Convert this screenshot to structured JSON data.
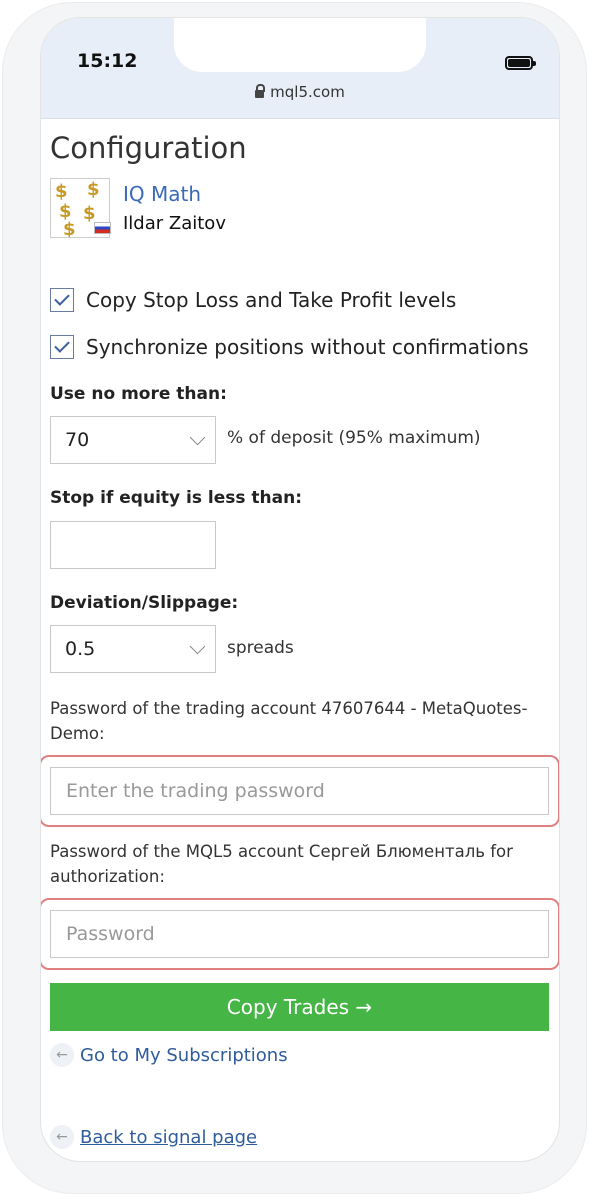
{
  "status_bar": {
    "time": "15:12",
    "url": "mql5.com"
  },
  "page": {
    "title": "Configuration",
    "signal": {
      "name": "IQ Math",
      "author": "Ildar Zaitov"
    },
    "checkboxes": [
      {
        "label": "Copy Stop Loss and Take Profit levels",
        "checked": true
      },
      {
        "label": "Synchronize positions without confirmations",
        "checked": true
      }
    ],
    "deposit": {
      "label": "Use no more than:",
      "value": "70",
      "suffix": "% of deposit (95% maximum)"
    },
    "equity": {
      "label": "Stop if equity is less than:",
      "value": ""
    },
    "deviation": {
      "label": "Deviation/Slippage:",
      "value": "0.5",
      "suffix": "spreads"
    },
    "trading_password": {
      "label": "Password of the trading account 47607644 - MetaQuotes-Demo:",
      "placeholder": "Enter the trading password"
    },
    "mql5_password": {
      "label": "Password of the MQL5 account Сергей Блюменталь for authorization:",
      "placeholder": "Password"
    },
    "copy_button": "Copy Trades →",
    "links": {
      "subscriptions": "Go to My Subscriptions",
      "back": "Back to signal page"
    },
    "arrow_glyph": "←"
  },
  "colors": {
    "button": "#45b545",
    "link": "#2f5c9a",
    "highlight": "#e08080"
  }
}
